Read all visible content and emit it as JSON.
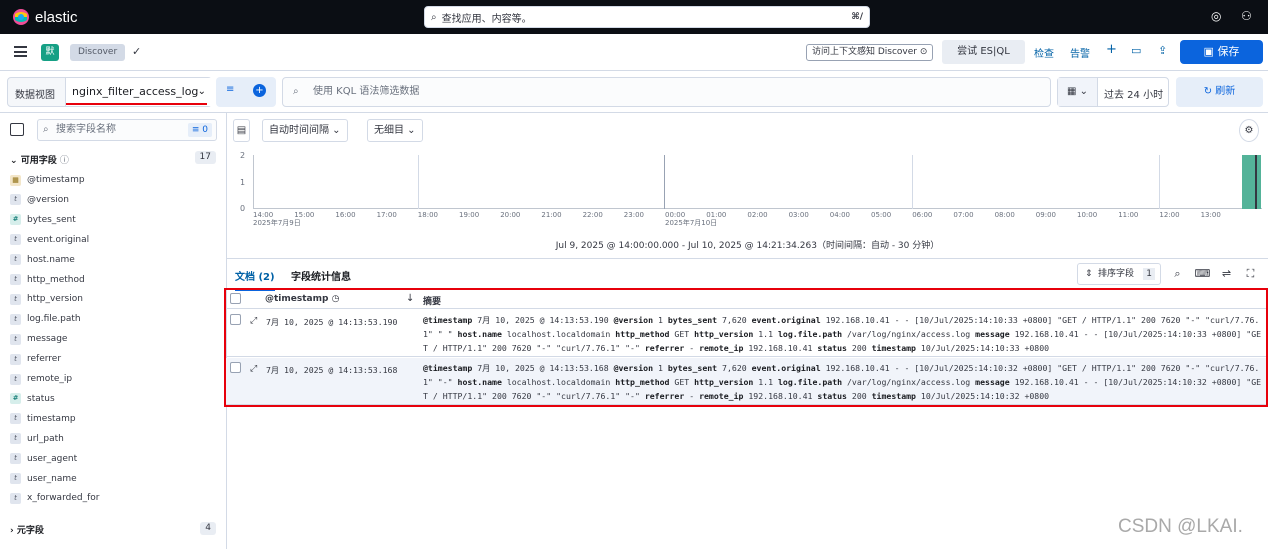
{
  "app": {
    "brand": "elastic",
    "search_placeholder": "查找应用、内容等。",
    "search_kbd": "⌘/"
  },
  "breadcrumb": {
    "avatar": "默",
    "current": "Discover"
  },
  "header": {
    "help_link": "访问上下文感知 Discover",
    "esql_btn": "尝试 ES|QL",
    "inspect": "检查",
    "alerts": "告警",
    "save": "保存"
  },
  "querybar": {
    "dataview_label": "数据视图",
    "dataview_value": "nginx_filter_access_log",
    "kql_placeholder": "使用 KQL 语法筛选数据",
    "time_range": "过去 24 小时",
    "refresh": "刷新"
  },
  "sidebar": {
    "search_placeholder": "搜索字段名称",
    "filter_count": "0",
    "available_header": "可用字段",
    "available_count": "17",
    "fields": [
      {
        "name": "@timestamp",
        "type": "date"
      },
      {
        "name": "@version",
        "type": "t"
      },
      {
        "name": "bytes_sent",
        "type": "#"
      },
      {
        "name": "event.original",
        "type": "t"
      },
      {
        "name": "host.name",
        "type": "t"
      },
      {
        "name": "http_method",
        "type": "t"
      },
      {
        "name": "http_version",
        "type": "t"
      },
      {
        "name": "log.file.path",
        "type": "t"
      },
      {
        "name": "message",
        "type": "t"
      },
      {
        "name": "referrer",
        "type": "t"
      },
      {
        "name": "remote_ip",
        "type": "t"
      },
      {
        "name": "status",
        "type": "#"
      },
      {
        "name": "timestamp",
        "type": "t"
      },
      {
        "name": "url_path",
        "type": "t"
      },
      {
        "name": "user_agent",
        "type": "t"
      },
      {
        "name": "user_name",
        "type": "t"
      },
      {
        "name": "x_forwarded_for",
        "type": "t"
      }
    ],
    "meta_header": "元字段",
    "meta_count": "4"
  },
  "histogram_controls": {
    "interval": "自动时间间隔",
    "breakdown": "无细目"
  },
  "chart_data": {
    "type": "bar",
    "y_ticks": [
      "2",
      "1",
      "0"
    ],
    "x_ticks": [
      "14:00\n2025年7月9日",
      "15:00",
      "16:00",
      "17:00",
      "18:00",
      "19:00",
      "20:00",
      "21:00",
      "22:00",
      "23:00",
      "00:00\n2025年7月10日",
      "01:00",
      "02:00",
      "03:00",
      "04:00",
      "05:00",
      "06:00",
      "07:00",
      "08:00",
      "09:00",
      "10:00",
      "11:00",
      "12:00",
      "13:00"
    ],
    "ylim": [
      0,
      2
    ],
    "bars": [
      {
        "x": "14:00 Jul 10",
        "value": 2
      }
    ],
    "accent": "#54b399"
  },
  "time_range_text": "Jul 9, 2025 @ 14:00:00.000 - Jul 10, 2025 @ 14:21:34.263（时间间隔：自动 - 30 分钟）",
  "tabs": {
    "docs": "文档 (2)",
    "stats": "字段统计信息"
  },
  "grid": {
    "sort_label": "排序字段",
    "sort_count": "1",
    "col_timestamp": "@timestamp",
    "col_summary": "摘要",
    "rows": [
      {
        "ts": "7月 10, 2025 @ 14:13:53.190",
        "summary_html": "<b>@timestamp</b> 7月 10, 2025 @ 14:13:53.190 <b>@version</b> 1 <b>bytes_sent</b> 7,620 <b>event.original</b> 192.168.10.41 - - [10/Jul/2025:14:10:33 +0800] \"GET / HTTP/1.1\" 200 7620 \"-\" \"curl/7.76.1\" \" \" <b>host.name</b> localhost.localdomain <b>http_method</b> GET <b>http_version</b> 1.1 <b>log.file.path</b> /var/log/nginx/access.log <b>message</b> 192.168.10.41 - - [10/Jul/2025:14:10:33 +0800] \"GET / HTTP/1.1\" 200 7620 \"-\" \"curl/7.76.1\" \"-\" <b>referrer</b> - <b>remote_ip</b> 192.168.10.41 <b>status</b> 200 <b>timestamp</b> 10/Jul/2025:14:10:33 +0800"
      },
      {
        "ts": "7月 10, 2025 @ 14:13:53.168",
        "summary_html": "<b>@timestamp</b> 7月 10, 2025 @ 14:13:53.168 <b>@version</b> 1 <b>bytes_sent</b> 7,620 <b>event.original</b> 192.168.10.41 - - [10/Jul/2025:14:10:32 +0800] \"GET / HTTP/1.1\" 200 7620 \"-\" \"curl/7.76.1\" \"-\" <b>host.name</b> localhost.localdomain <b>http_method</b> GET <b>http_version</b> 1.1 <b>log.file.path</b> /var/log/nginx/access.log <b>message</b> 192.168.10.41 - - [10/Jul/2025:14:10:32 +0800] \"GET / HTTP/1.1\" 200 7620 \"-\" \"curl/7.76.1\" \"-\" <b>referrer</b> - <b>remote_ip</b> 192.168.10.41 <b>status</b> 200 <b>timestamp</b> 10/Jul/2025:14:10:32 +0800"
      }
    ]
  },
  "watermark": "CSDN @LKAI."
}
